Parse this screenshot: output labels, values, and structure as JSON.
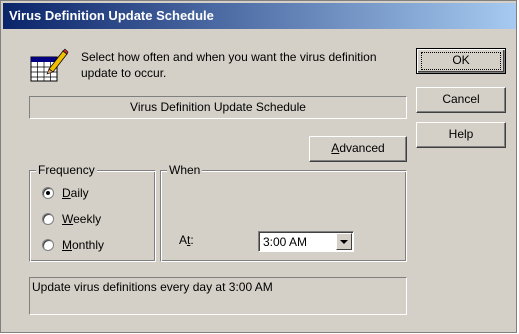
{
  "window": {
    "title": "Virus Definition Update Schedule"
  },
  "intro": {
    "text": "Select how often and when you want the virus definition update to occur.",
    "icon": "calendar-pencil-icon"
  },
  "schedule_name": "Virus Definition Update Schedule",
  "buttons": {
    "ok": "OK",
    "cancel": "Cancel",
    "help": "Help",
    "advanced": "Advanced"
  },
  "frequency": {
    "label": "Frequency",
    "options": [
      {
        "label": "Daily",
        "checked": true
      },
      {
        "label": "Weekly",
        "checked": false
      },
      {
        "label": "Monthly",
        "checked": false
      }
    ]
  },
  "when": {
    "label": "When",
    "at_label": "At:",
    "time_value": "3:00 AM"
  },
  "summary": "Update virus definitions every day at 3:00 AM"
}
